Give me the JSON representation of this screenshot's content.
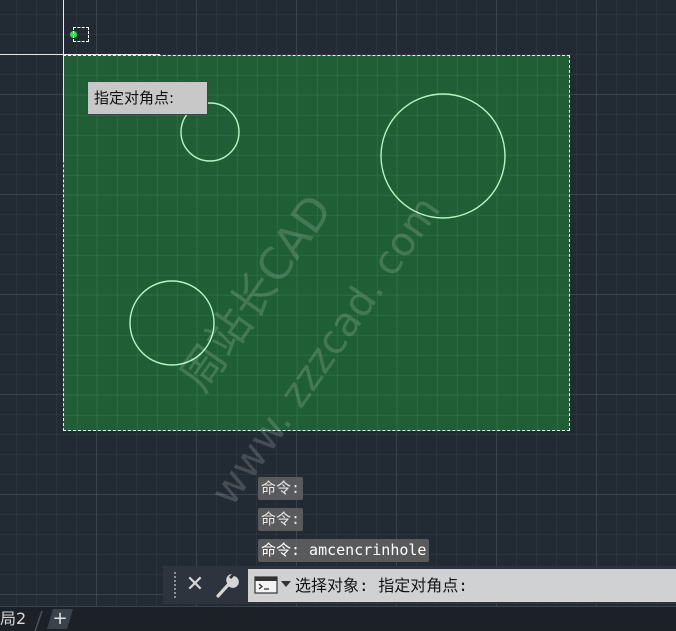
{
  "tooltip": {
    "text": "指定对角点:"
  },
  "watermark": {
    "line1": "周站长CAD",
    "line2": "www. zzzcad. com"
  },
  "command_history": [
    "命令:",
    "命令:",
    "命令: amcencrinhole"
  ],
  "command_line": {
    "prompt": "选择对象: 指定对角点:"
  },
  "layout_tabs": {
    "current_tab_label": "局2",
    "add_tab_label": "+"
  },
  "colors": {
    "canvas_background": "#222a33",
    "selection_fill": "#206e36",
    "circle_stroke": "#b8f5c4",
    "grip_color": "#2fe04a"
  },
  "icons": {
    "close": "close-icon",
    "customize": "wrench-icon",
    "command_prompt": "command-prompt-icon",
    "dropdown": "chevron-down-icon"
  }
}
